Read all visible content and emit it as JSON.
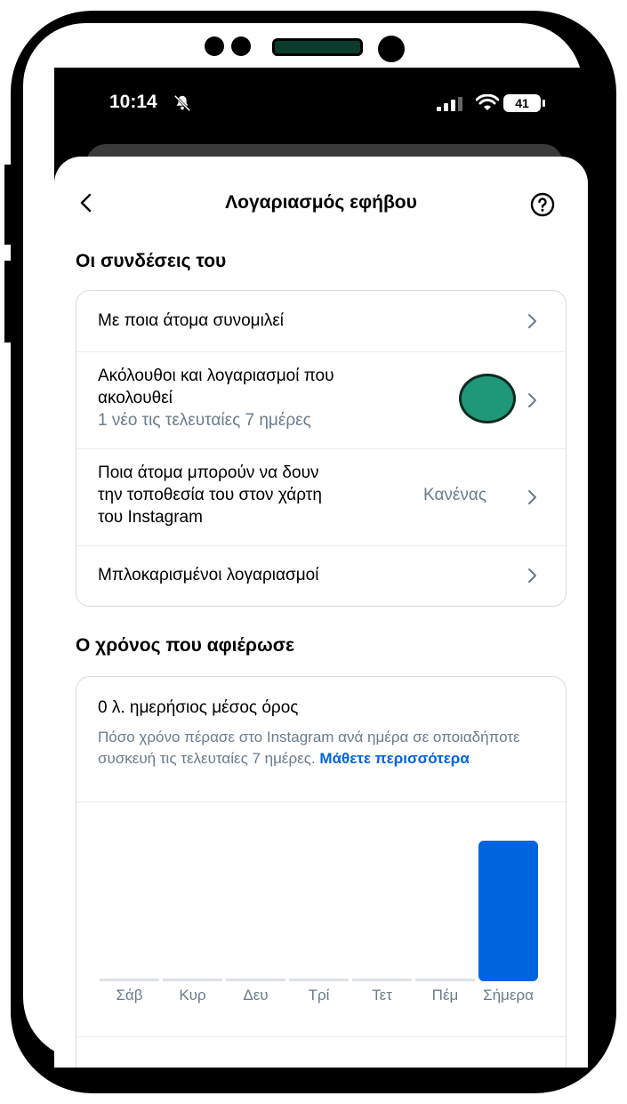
{
  "status_bar": {
    "time": "10:14",
    "battery": "41"
  },
  "header": {
    "title": "Λογαριασμός εφήβου"
  },
  "connections": {
    "title": "Οι συνδέσεις του",
    "items": [
      {
        "label": "Με ποια άτομα συνομιλεί"
      },
      {
        "label_line1": "Ακόλουθοι και λογαριασμοί που",
        "label_line2": "ακολουθεί",
        "sub": "1 νέο τις τελευταίες 7 ημέρες"
      },
      {
        "label_line1": "Ποια άτομα μπορούν να δουν",
        "label_line2": "την τοποθεσία του στον χάρτη",
        "label_line3": "του Instagram",
        "value": "Κανένας"
      },
      {
        "label": "Μπλοκαρισμένοι λογαριασμοί"
      }
    ]
  },
  "time_spent": {
    "title": "Ο χρόνος που αφιέρωσε",
    "daily_average": "0 λ. ημερήσιος μέσος όρος",
    "description": "Πόσο χρόνο πέρασε στο Instagram ανά ημέρα σε οποιαδήποτε συσκευή τις τελευταίες 7 ημέρες.",
    "learn_more": "Μάθετε περισσότερα"
  },
  "chart_data": {
    "type": "bar",
    "categories": [
      "Σάβ",
      "Κυρ",
      "Δευ",
      "Τρί",
      "Τετ",
      "Πέμ",
      "Σήμερα"
    ],
    "values": [
      0,
      0,
      0,
      0,
      0,
      0,
      1
    ],
    "colors": {
      "bar": "#0064e0",
      "empty": "#dde1e6"
    }
  },
  "colors": {
    "accent": "#0064e0",
    "muted": "#6b7b8c",
    "marker": "#1f9877"
  }
}
